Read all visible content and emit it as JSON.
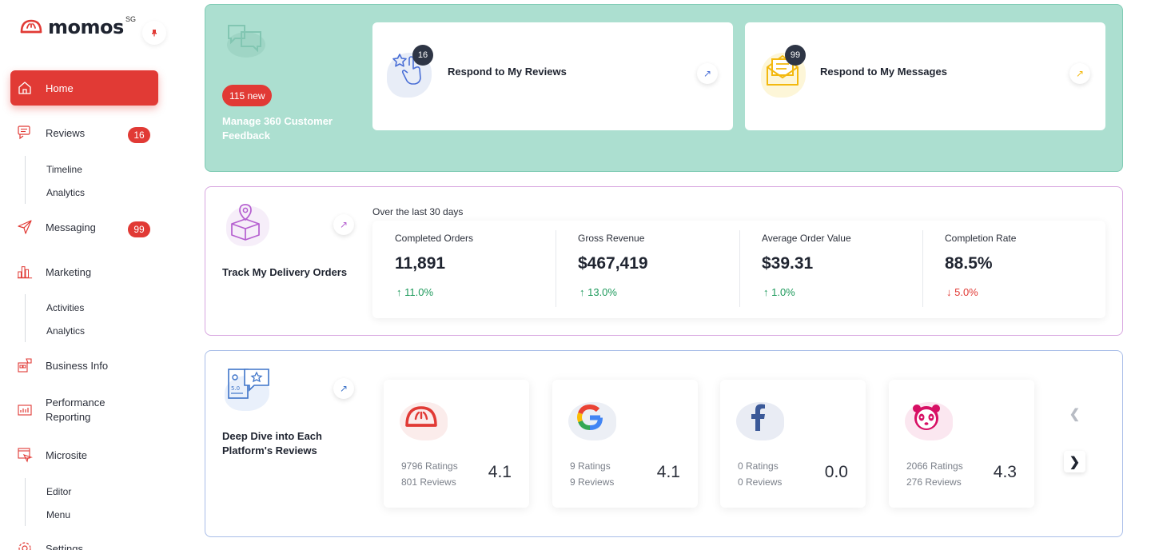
{
  "brand": {
    "name": "momos",
    "region": "SG"
  },
  "sidebar": {
    "items": [
      {
        "label": "Home",
        "icon": "home-icon"
      },
      {
        "label": "Reviews",
        "icon": "reviews-icon",
        "badge": "16"
      },
      {
        "label": "Messaging",
        "icon": "send-icon",
        "badge": "99"
      },
      {
        "label": "Marketing",
        "icon": "bar-chart-icon"
      },
      {
        "label": "Business Info",
        "icon": "business-info-icon"
      },
      {
        "label": "Performance Reporting",
        "icon": "report-icon"
      },
      {
        "label": "Microsite",
        "icon": "microsite-icon"
      },
      {
        "label": "Settings",
        "icon": "gear-icon"
      }
    ],
    "reviews_sub": [
      "Timeline",
      "Analytics"
    ],
    "marketing_sub": [
      "Activities",
      "Analytics"
    ],
    "microsite_sub": [
      "Editor",
      "Menu"
    ]
  },
  "feedback": {
    "new_count": "115 new",
    "title": "Manage 360 Customer Feedback",
    "reviews_card": {
      "label": "Respond to My Reviews",
      "badge": "16"
    },
    "messages_card": {
      "label": "Respond to My Messages",
      "badge": "99"
    }
  },
  "delivery": {
    "title": "Track My Delivery Orders",
    "period": "Over the last 30 days",
    "stats": [
      {
        "label": "Completed Orders",
        "value": "11,891",
        "change": "↑ 11.0%",
        "direction": "up"
      },
      {
        "label": "Gross Revenue",
        "value": "$467,419",
        "change": "↑ 13.0%",
        "direction": "up"
      },
      {
        "label": "Average Order Value",
        "value": "$39.31",
        "change": "↑ 1.0%",
        "direction": "up"
      },
      {
        "label": "Completion Rate",
        "value": "88.5%",
        "change": "↓ 5.0%",
        "direction": "down"
      }
    ]
  },
  "platforms": {
    "title": "Deep Dive into Each Platform's Reviews",
    "items": [
      {
        "name": "momos",
        "ratings": "9796 Ratings",
        "reviews": "801 Reviews",
        "score": "4.1"
      },
      {
        "name": "google",
        "ratings": "9 Ratings",
        "reviews": "9 Reviews",
        "score": "4.1"
      },
      {
        "name": "facebook",
        "ratings": "0 Ratings",
        "reviews": "0 Reviews",
        "score": "0.0"
      },
      {
        "name": "foodpanda",
        "ratings": "2066 Ratings",
        "reviews": "276 Reviews",
        "score": "4.3"
      }
    ]
  },
  "colors": {
    "accent": "#e13a35",
    "feedback_panel": "#acdfd0",
    "positive": "#1e9a5c",
    "negative": "#e13a35"
  }
}
